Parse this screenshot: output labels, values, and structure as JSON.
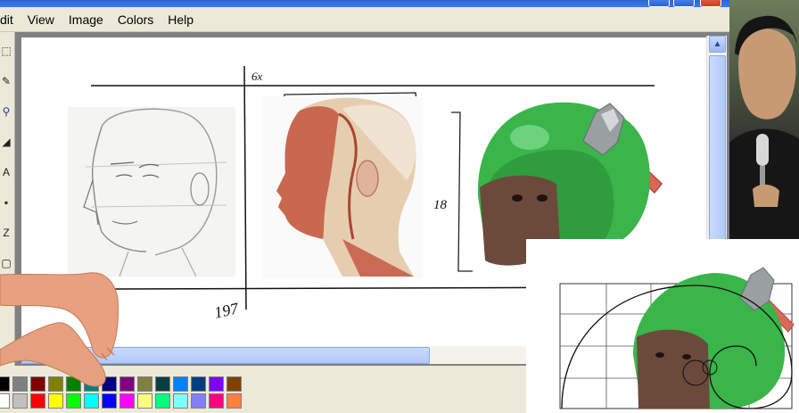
{
  "menu": {
    "items": [
      "dit",
      "View",
      "Image",
      "Colors",
      "Help"
    ]
  },
  "canvas": {
    "annotation_top": "6x",
    "annotation_side": "18",
    "annotation_bottom": "197"
  },
  "toolbox": {
    "tools": [
      "select-icon",
      "pencil-icon",
      "magnifier-icon",
      "fill-icon",
      "text-icon",
      "brush-icon",
      "airbrush-icon",
      "ellipse-icon"
    ]
  },
  "scrollbars": {
    "up_arrow": "▲"
  },
  "palette": {
    "row1": [
      "#000000",
      "#808080",
      "#800000",
      "#808000",
      "#008000",
      "#008080",
      "#000080",
      "#800080",
      "#808040",
      "#004040",
      "#0080ff",
      "#004080",
      "#8000ff",
      "#804000"
    ],
    "row2": [
      "#ffffff",
      "#c0c0c0",
      "#ff0000",
      "#ffff00",
      "#00ff00",
      "#00ffff",
      "#0000ff",
      "#ff00ff",
      "#ffff80",
      "#00ff80",
      "#80ffff",
      "#8080ff",
      "#ff0080",
      "#ff8040"
    ]
  },
  "colors": {
    "helmet": "#3ab54a",
    "axe_handle": "#d9675a",
    "skin": "#e8a07f",
    "titlebar": "#2b66d9"
  }
}
